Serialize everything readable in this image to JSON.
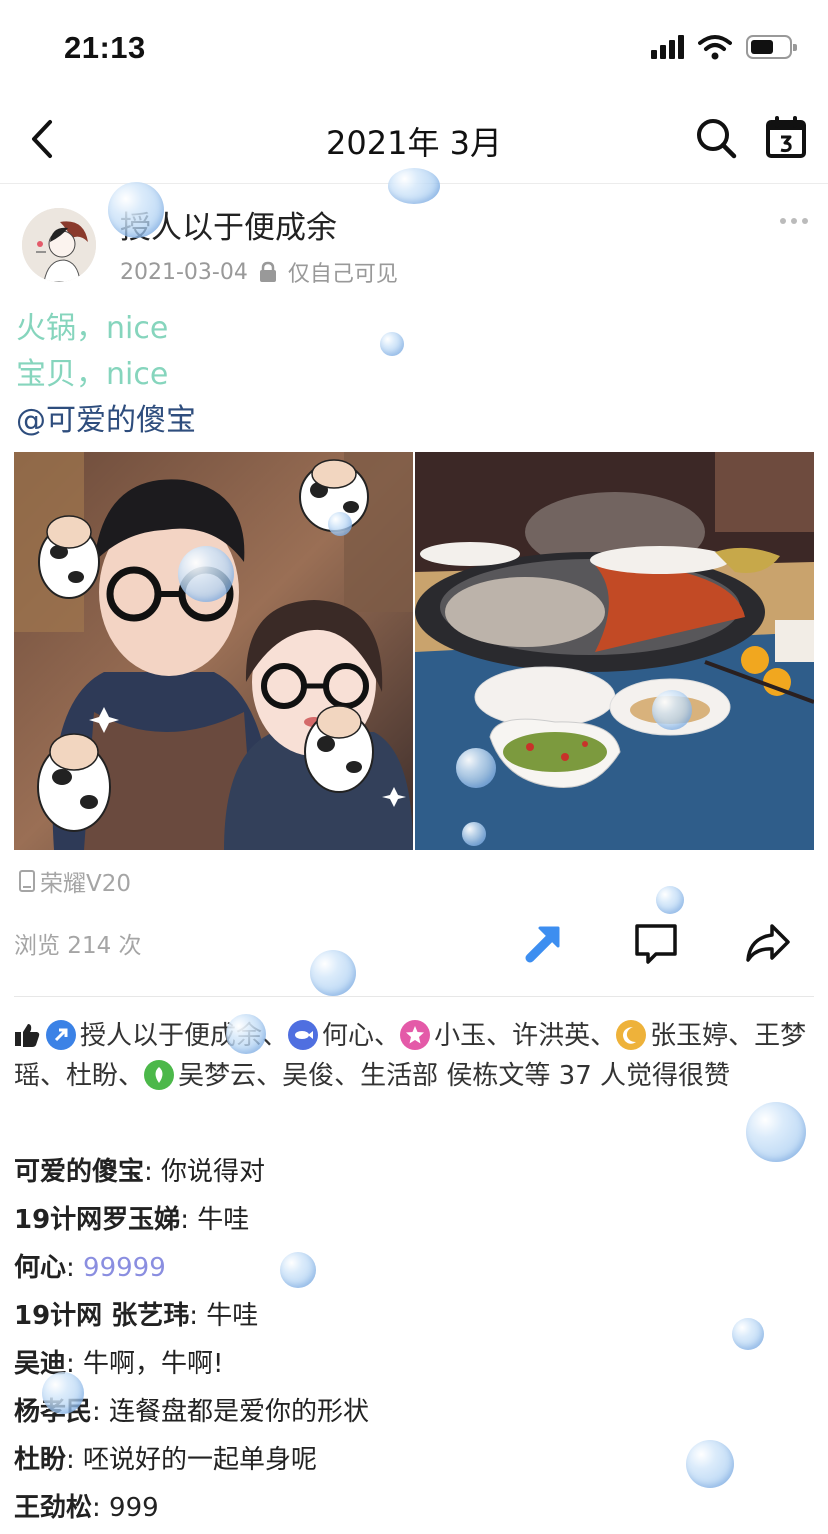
{
  "status_bar": {
    "time": "21:13"
  },
  "nav": {
    "title": "2021年 3月"
  },
  "post": {
    "author": "授人以于便成余",
    "date": "2021-03-04",
    "visibility": "仅自己可见",
    "lines": [
      "火锅，nice",
      "宝贝，nice"
    ],
    "mention": "@可爱的傻宝",
    "device": "荣耀V20",
    "views": "浏览 214 次"
  },
  "likes": {
    "names": [
      "授人以于便成余",
      "何心",
      "小玉",
      "许洪英",
      "张玉婷",
      "王梦瑶",
      "杜盼",
      "吴梦云",
      "吴俊",
      "生活部",
      "侯栋文"
    ],
    "suffix": "等 37 人觉得很赞"
  },
  "comments": [
    {
      "author": "可爱的傻宝",
      "text": "你说得对"
    },
    {
      "author": "19计网罗玉娣",
      "text": "牛哇"
    },
    {
      "author": "何心",
      "text": "99999"
    },
    {
      "author": "19计网 张艺玮",
      "text": "牛哇"
    },
    {
      "author": "吴迪",
      "text": "牛啊，牛啊!"
    },
    {
      "author": "杨孝民",
      "text": "连餐盘都是爱你的形状"
    },
    {
      "author": "杜盼",
      "text": "呸说好的一起单身呢"
    },
    {
      "author": "王劲松",
      "text": "999"
    }
  ],
  "colors": {
    "post_text_green": "#86d5bd",
    "mention": "#2e4d7d",
    "comment_highlight": "#8a8ee0",
    "share_accent": "#3d8ef0"
  }
}
